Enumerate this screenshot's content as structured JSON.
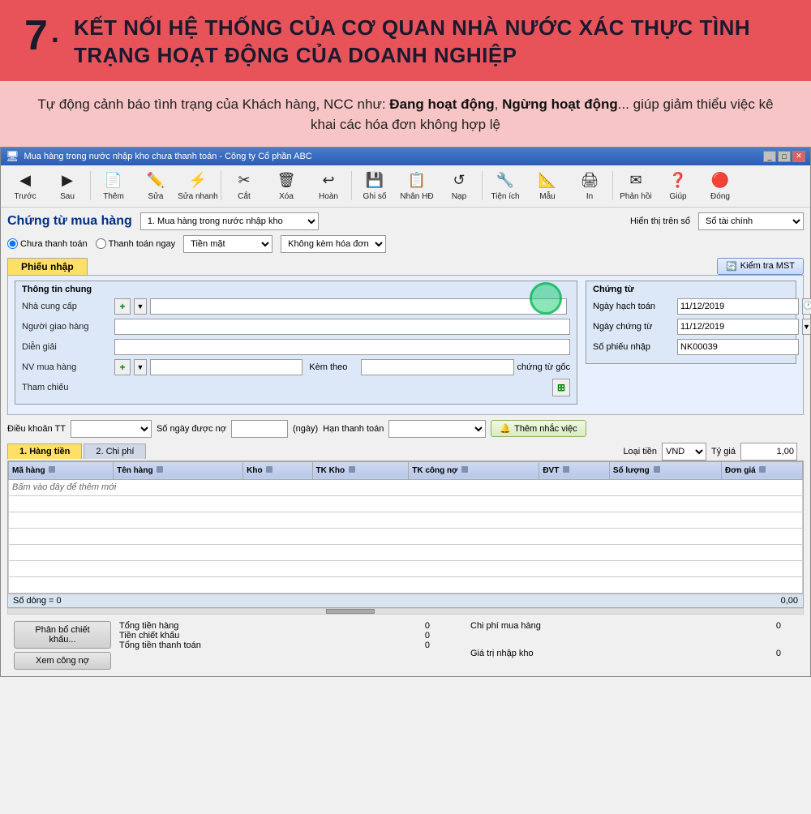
{
  "header": {
    "number": "7",
    "title": "KẾT NỐI HỆ THỐNG CỦA CƠ QUAN NHÀ NƯỚC XÁC THỰC TÌNH TRẠNG HOẠT ĐỘNG CỦA DOANH NGHIỆP"
  },
  "subtitle": {
    "text_prefix": "Tự động cảnh báo tình trạng của Khách hàng, NCC như: ",
    "text_bold1": "Đang hoạt động",
    "text_middle": ", ",
    "text_bold2": "Ngừng hoạt động",
    "text_suffix": "... giúp giảm thiểu việc kê khai các hóa đơn không hợp lệ"
  },
  "window": {
    "title": "Mua hàng trong nước nhập kho chưa thanh toán - Công ty Cổ phần ABC",
    "controls": [
      "_",
      "□",
      "✕"
    ]
  },
  "toolbar": {
    "buttons": [
      {
        "label": "Trước",
        "icon": "◀"
      },
      {
        "label": "Sau",
        "icon": "▶"
      },
      {
        "label": "Thêm",
        "icon": "📄"
      },
      {
        "label": "Sửa",
        "icon": "✏️"
      },
      {
        "label": "Sửa nhanh",
        "icon": "⚡"
      },
      {
        "label": "Cắt",
        "icon": "✂"
      },
      {
        "label": "Xóa",
        "icon": "🗑"
      },
      {
        "label": "Hoàn",
        "icon": "↩"
      },
      {
        "label": "Ghi số",
        "icon": "💾"
      },
      {
        "label": "Nhân HĐ",
        "icon": "📋"
      },
      {
        "label": "Nạp",
        "icon": "↺"
      },
      {
        "label": "Tiện ích",
        "icon": "🔧"
      },
      {
        "label": "Mẫu",
        "icon": "📐"
      },
      {
        "label": "In",
        "icon": "🖨"
      },
      {
        "label": "Phản hồi",
        "icon": "✉"
      },
      {
        "label": "Giúp",
        "icon": "❓"
      },
      {
        "label": "Đóng",
        "icon": "🔴"
      }
    ]
  },
  "form": {
    "chung_tu_label": "Chứng từ mua hàng",
    "chung_tu_select": "1. Mua hàng trong nước nhập kho",
    "hien_thi_label": "Hiển thị trên sổ",
    "hien_thi_value": "Sổ tài chính",
    "payment_options": [
      "Chưa thanh toán",
      "Thanh toán ngay"
    ],
    "payment_selected": "Chưa thanh toán",
    "tien_mat": "Tiền mặt",
    "hoa_don": "Không kèm hóa đơn",
    "tab_phieu_nhap": "Phiếu nhập",
    "kiemtra_mst": "Kiểm tra MST",
    "thong_tin_chung": "Thông tin chung",
    "fields": {
      "nha_cung_cap": "Nhà cung cấp",
      "nguoi_giao_hang": "Người giao hàng",
      "dien_giai": "Diễn giải",
      "nv_mua_hang": "NV mua hàng",
      "kem_theo": "Kèm theo",
      "chung_tu_goc": "chứng từ gốc",
      "tham_chieu": "Tham chiếu"
    },
    "chung_tu_panel": {
      "title": "Chứng từ",
      "ngay_hach_toan": "Ngày hạch toán",
      "ngay_chung_tu": "Ngày chứng từ",
      "so_phieu_nhap": "Số phiếu nhập",
      "ngay_ht_value": "11/12/2019",
      "ngay_ct_value": "11/12/2019",
      "so_phieu_value": "NK00039"
    },
    "terms": {
      "dieu_khoan_tt": "Điều khoản TT",
      "so_ngay_duoc_no": "Số ngày được nợ",
      "ngay_unit": "(ngày)",
      "han_thanh_toan": "Hạn thanh toán",
      "them_nhac_viec": "Thêm nhắc việc"
    },
    "tabs": {
      "tab1": "1. Hàng tiền",
      "tab2": "2. Chi phí"
    },
    "loai_tien": {
      "label": "Loại tiền",
      "value": "VND",
      "ty_gia_label": "Tỷ giá",
      "ty_gia_value": "1,00"
    }
  },
  "table": {
    "columns": [
      "Mã hàng",
      "Tên hàng",
      "Kho",
      "TK Kho",
      "TK công nợ",
      "ĐVT",
      "Số lượng",
      "Đơn giá"
    ],
    "add_row_text": "Bấm vào đây để thêm mới",
    "so_dong": "Số dòng = 0",
    "total_value": "0,00"
  },
  "bottom": {
    "btn_phan_bo": "Phân bổ chiết khấu...",
    "btn_xem_cong_no": "Xem công nợ",
    "tong_tien_hang_label": "Tổng tiền hàng",
    "tong_tien_hang_value": "0",
    "tien_chiet_khau_label": "Tiền chiết khấu",
    "tien_chiet_khau_value": "0",
    "tong_tien_tt_label": "Tổng tiền thanh toán",
    "tong_tien_tt_value": "0",
    "chi_phi_mh_label": "Chi phí mua hàng",
    "chi_phi_mh_value": "0",
    "gia_tri_nhap_kho_label": "Giá trị nhập kho",
    "gia_tri_nhap_kho_value": "0"
  },
  "colors": {
    "header_bg": "#e8535a",
    "subtitle_bg": "#f7c5c5",
    "accent_blue": "#003087",
    "window_title_bg": "#4a7cc7",
    "tab_active": "#ffe066"
  }
}
